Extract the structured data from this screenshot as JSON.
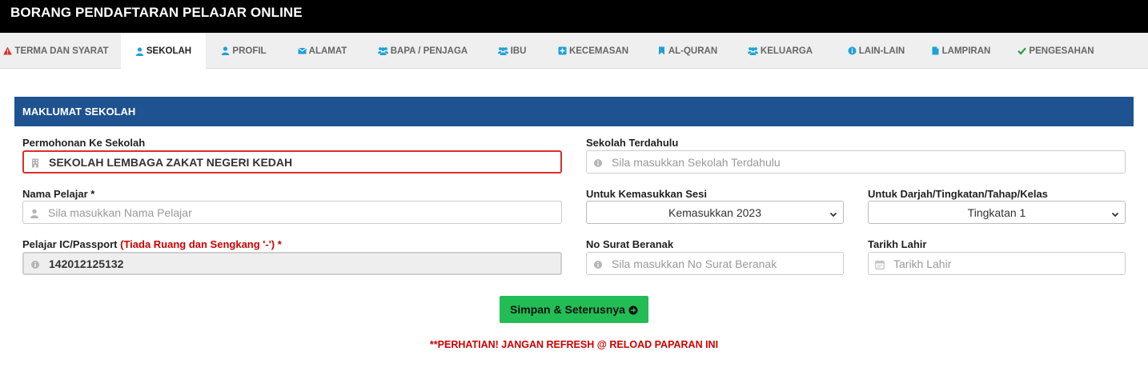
{
  "header": {
    "title": "BORANG PENDAFTARAN PELAJAR ONLINE"
  },
  "tabs": [
    {
      "label": "TERMA DAN SYARAT",
      "icon": "warning-icon"
    },
    {
      "label": "SEKOLAH",
      "icon": "user-icon",
      "active": true
    },
    {
      "label": "PROFIL",
      "icon": "user-icon"
    },
    {
      "label": "ALAMAT",
      "icon": "envelope-icon"
    },
    {
      "label": "BAPA / PENJAGA",
      "icon": "users-icon"
    },
    {
      "label": "IBU",
      "icon": "users-icon"
    },
    {
      "label": "KECEMASAN",
      "icon": "plus-square-icon"
    },
    {
      "label": "AL-QURAN",
      "icon": "bookmark-icon"
    },
    {
      "label": "KELUARGA",
      "icon": "users-icon"
    },
    {
      "label": "LAIN-LAIN",
      "icon": "info-icon"
    },
    {
      "label": "LAMPIRAN",
      "icon": "file-icon"
    },
    {
      "label": "PENGESAHAN",
      "icon": "check-icon"
    }
  ],
  "colors": {
    "header_bg": "#000000",
    "panel_bg": "#1e5290",
    "button_bg": "#22bd55",
    "warning": "#cc0000",
    "tab_icon": "#1ea1d8"
  },
  "section": {
    "title": "MAKLUMAT SEKOLAH"
  },
  "form": {
    "school": {
      "label": "Permohonan Ke Sekolah",
      "value": "SEKOLAH LEMBAGA ZAKAT NEGERI KEDAH"
    },
    "prev_school": {
      "label": "Sekolah Terdahulu",
      "placeholder": "Sila masukkan Sekolah Terdahulu"
    },
    "name": {
      "label": "Nama Pelajar *",
      "placeholder": "Sila masukkan Nama Pelajar"
    },
    "session": {
      "label": "Untuk Kemasukkan Sesi",
      "value": "Kemasukkan 2023"
    },
    "grade": {
      "label": "Untuk Darjah/Tingkatan/Tahap/Kelas",
      "value": "Tingkatan 1"
    },
    "ic": {
      "label": "Pelajar IC/Passport",
      "note": "(Tiada Ruang dan Sengkang '-') *",
      "value": "142012125132"
    },
    "birth_cert": {
      "label": "No Surat Beranak",
      "placeholder": "Sila masukkan No Surat Beranak"
    },
    "dob": {
      "label": "Tarikh Lahir",
      "placeholder": "Tarikh Lahir"
    }
  },
  "submit": {
    "label": "Simpan & Seterusnya"
  },
  "notice": "**PERHATIAN! JANGAN REFRESH @ RELOAD PAPARAN INI"
}
